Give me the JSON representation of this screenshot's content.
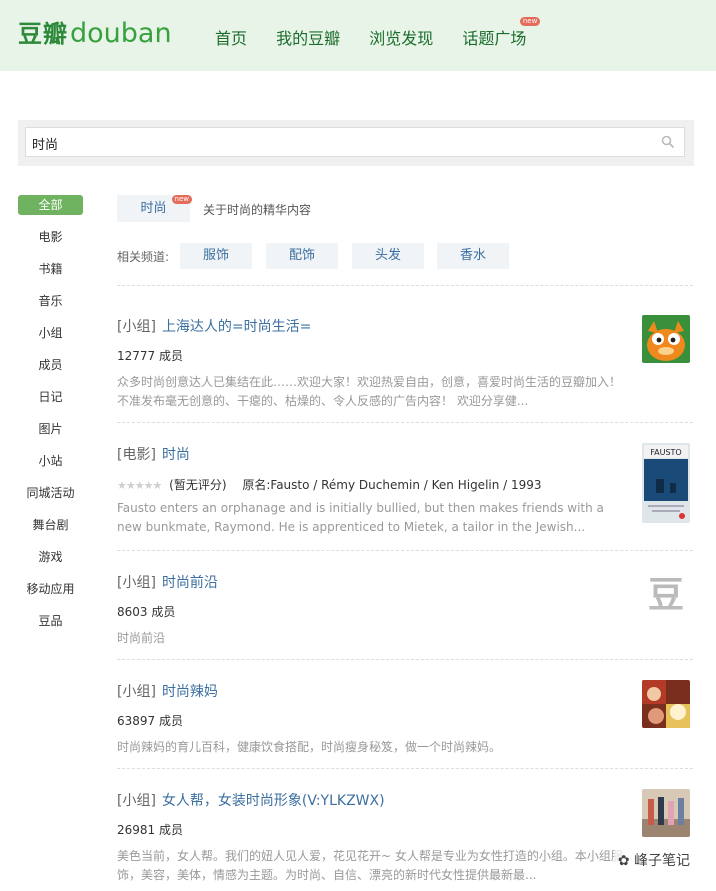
{
  "header": {
    "logo_cn": "豆瓣",
    "logo_en": "douban",
    "nav": [
      "首页",
      "我的豆瓣",
      "浏览发现",
      "话题广场"
    ],
    "nav_badge": "new"
  },
  "search": {
    "value": "时尚"
  },
  "categories": [
    "全部",
    "电影",
    "书籍",
    "音乐",
    "小组",
    "成员",
    "日记",
    "图片",
    "小站",
    "同城活动",
    "舞台剧",
    "游戏",
    "移动应用",
    "豆品"
  ],
  "topic": {
    "tag": "时尚",
    "badge": "new",
    "desc": "关于时尚的精华内容",
    "related_label": "相关频道:",
    "related": [
      "服饰",
      "配饰",
      "头发",
      "香水"
    ]
  },
  "results": [
    {
      "type": "[小组]",
      "title": "上海达人的=时尚生活=",
      "meta": "12777 成员",
      "desc": "众多时尚创意达人已集结在此……欢迎大家！欢迎热爱自由，创意，喜爱时尚生活的豆瓣加入！ 不准发布毫无创意的、干瘪的、枯燥的、令人反感的广告内容！ 欢迎分享健..."
    },
    {
      "type": "[电影]",
      "title": "时尚",
      "stars": "★★★★★",
      "rating": "(暂无评分)",
      "info": "原名:Fausto / Rémy Duchemin / Ken Higelin / 1993",
      "desc": "Fausto enters an orphanage and is initially bullied, but then makes friends with a new bunkmate, Raymond. He is apprenticed to Mietek, a tailor in the Jewish...",
      "poster_text": "FAUSTO"
    },
    {
      "type": "[小组]",
      "title": "时尚前沿",
      "meta": "8603 成员",
      "desc": "时尚前沿",
      "icon_char": "豆"
    },
    {
      "type": "[小组]",
      "title": "时尚辣妈",
      "meta": "63897 成员",
      "desc": "时尚辣妈的育儿百科，健康饮食搭配，时尚瘦身秘笈，做一个时尚辣妈。"
    },
    {
      "type": "[小组]",
      "title": "女人帮，女装时尚形象(V:YLKZWX)",
      "meta": "26981 成员",
      "desc": "美色当前，女人帮。我们的妞人见人爱，花见花开~ 女人帮是专业为女性打造的小组。本小组服饰，美容，美体，情感为主题。为时尚、自信、漂亮的新时代女性提供最新最..."
    }
  ],
  "watermark": "峰子笔记",
  "colors": {
    "header_bg": "#e9f4e9",
    "brand": "#37a13e",
    "link": "#3b6fa0",
    "active_cat": "#6fb360"
  }
}
